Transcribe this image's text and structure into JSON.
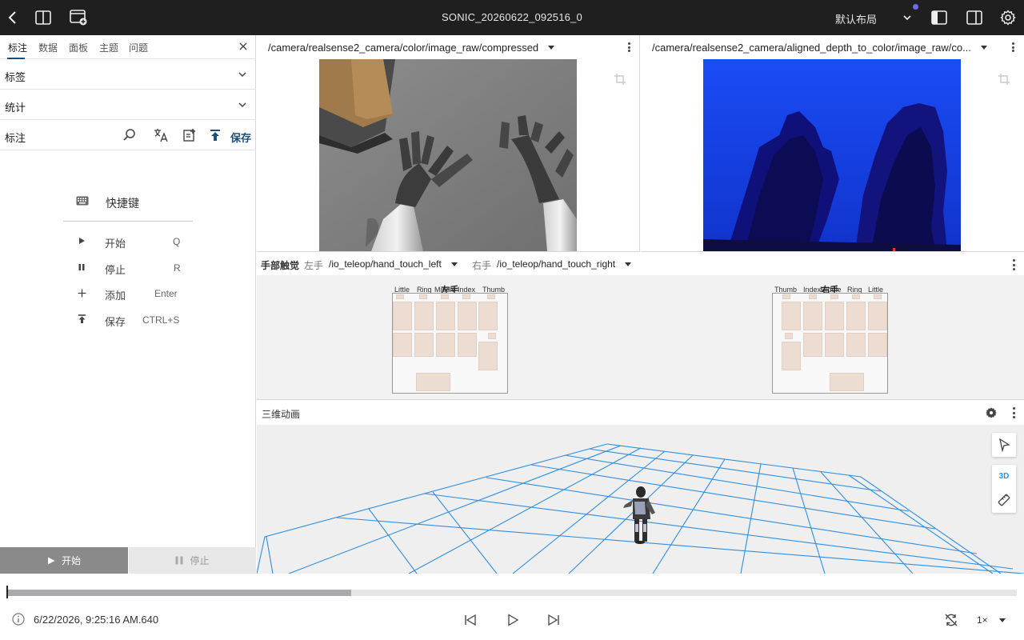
{
  "titlebar": {
    "title": "SONIC_20260622_092516_0",
    "layout_label": "默认布局"
  },
  "sidebar": {
    "tabs": [
      "标注",
      "数据",
      "面板",
      "主题",
      "问题"
    ],
    "active_tab": 0,
    "sections": {
      "tags": "标签",
      "stats": "统计",
      "annotations": "标注"
    },
    "save_label": "保存",
    "shortcuts": {
      "title": "快捷键",
      "items": [
        {
          "name": "开始",
          "key": "Q",
          "icon": "play-icon"
        },
        {
          "name": "停止",
          "key": "R",
          "icon": "pause-icon"
        },
        {
          "name": "添加",
          "key": "Enter",
          "icon": "plus-icon"
        },
        {
          "name": "保存",
          "key": "CTRL+S",
          "icon": "upload-icon"
        }
      ]
    },
    "start_button": "开始",
    "stop_button": "停止"
  },
  "cameras": {
    "color_topic": "/camera/realsense2_camera/color/image_raw/compressed",
    "depth_topic": "/camera/realsense2_camera/aligned_depth_to_color/image_raw/co..."
  },
  "touch": {
    "title": "手部触觉",
    "left_label": "左手",
    "left_topic": "/io_teleop/hand_touch_left",
    "right_label": "右手",
    "right_topic": "/io_teleop/hand_touch_right",
    "left_hand_title": "左手",
    "right_hand_title": "右手",
    "left_fingers": [
      "Little",
      "Ring",
      "Middle",
      "Index",
      "Thumb"
    ],
    "right_fingers": [
      "Thumb",
      "Index",
      "Middle",
      "Ring",
      "Little"
    ]
  },
  "three": {
    "title": "三维动画",
    "mode_label": "3D",
    "colors": {
      "grid": "#2f8fe0",
      "background": "#efefef"
    }
  },
  "timeline": {
    "timestamp": "6/22/2026, 9:25:16 AM.640",
    "speed": "1×",
    "progress_fraction": 0.341
  }
}
